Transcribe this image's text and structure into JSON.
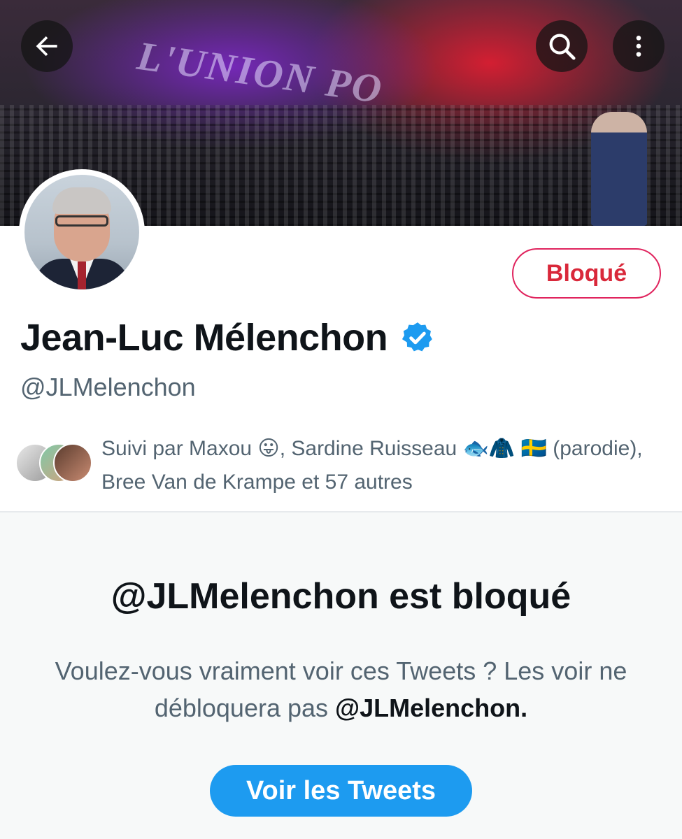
{
  "header": {
    "back_icon": "arrow-left-icon",
    "search_icon": "search-icon",
    "more_icon": "more-vertical-icon",
    "banner_text": "L'UNION PO"
  },
  "profile": {
    "name": "Jean-Luc Mélenchon",
    "handle": "@JLMelenchon",
    "verified": true,
    "blocked_button_label": "Bloqué",
    "followed_by_text": "Suivi par Maxou 😛, Sardine Ruisseau 🐟🧥 🇸🇪 (parodie), Bree Van de Krampe et 57 autres"
  },
  "blocked_notice": {
    "title": "@JLMelenchon est bloqué",
    "description_prefix": "Voulez-vous vraiment voir ces Tweets ? Les voir ne débloquera pas ",
    "description_handle": "@JLMelenchon.",
    "view_button_label": "Voir les Tweets"
  },
  "colors": {
    "blocked_red": "#d9283a",
    "accent_blue": "#1d9bf0",
    "secondary_text": "#536471"
  }
}
